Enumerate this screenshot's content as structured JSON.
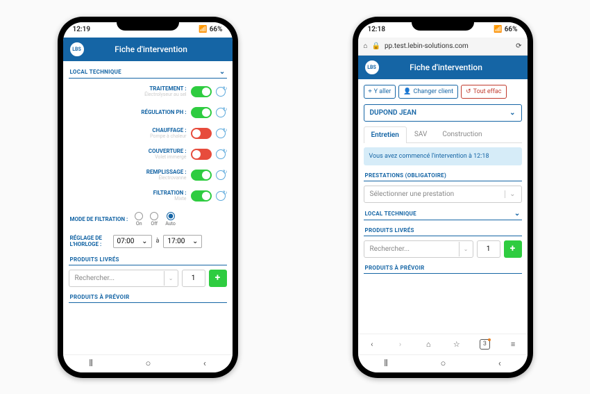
{
  "left": {
    "status": {
      "time": "12:19",
      "battery": "66%"
    },
    "header": {
      "title": "Fiche d'intervention"
    },
    "section_local": "LOCAL TECHNIQUE",
    "toggles": [
      {
        "label": "TRAITEMENT :",
        "sub": "Électrolyseur au sel",
        "on": true
      },
      {
        "label": "RÉGULATION PH :",
        "sub": "",
        "on": true
      },
      {
        "label": "CHAUFFAGE :",
        "sub": "Pompe à chaleur",
        "on": false
      },
      {
        "label": "COUVERTURE :",
        "sub": "Volet immergé",
        "on": false
      },
      {
        "label": "REMPLISSAGE :",
        "sub": "Électrovanne",
        "on": true
      },
      {
        "label": "FILTRATION :",
        "sub": "Mixte",
        "on": true
      }
    ],
    "mode": {
      "label": "MODE DE FILTRATION :",
      "options": [
        "On",
        "Off",
        "Auto"
      ],
      "selected": "Auto"
    },
    "clock": {
      "label": "RÉGLAGE DE L'HORLOGE :",
      "from": "07:00",
      "sep": "à",
      "to": "17:00"
    },
    "section_livres": "PRODUITS LIVRÉS",
    "search": {
      "placeholder": "Rechercher...",
      "qty": "1"
    },
    "section_prevoir": "PRODUITS À PRÉVOIR"
  },
  "right": {
    "status": {
      "time": "12:18",
      "battery": "66%"
    },
    "browser": {
      "url": "pp.test.lebin-solutions.com"
    },
    "header": {
      "title": "Fiche d'intervention"
    },
    "actions": {
      "go": "Y aller",
      "change": "Changer client",
      "clear": "Tout effac"
    },
    "client": "DUPOND JEAN",
    "tabs": [
      "Entretien",
      "SAV",
      "Construction"
    ],
    "banner": "Vous avez commencé l'intervention à 12:18",
    "section_presta": "PRESTATIONS (OBLIGATOIRE)",
    "presta_placeholder": "Sélectionner une prestation",
    "section_local": "LOCAL TECHNIQUE",
    "section_livres": "PRODUITS LIVRÉS",
    "search": {
      "placeholder": "Rechercher...",
      "qty": "1"
    },
    "section_prevoir": "PRODUITS À PRÉVOIR",
    "tabs_count": "3"
  }
}
